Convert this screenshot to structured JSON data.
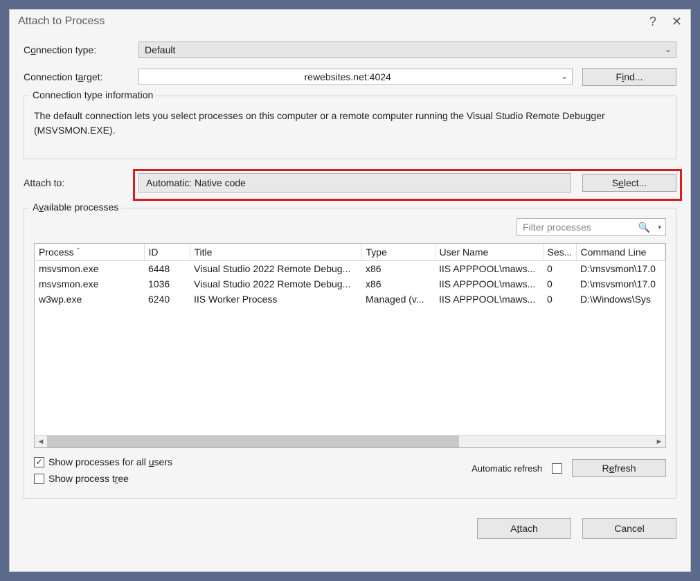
{
  "window": {
    "title": "Attach to Process",
    "help_icon": "?",
    "close_icon": "✕"
  },
  "labels": {
    "conn_type_pre": "C",
    "conn_type_u": "o",
    "conn_type_post": "nnection type:",
    "conn_target_pre": "Connection t",
    "conn_target_u": "a",
    "conn_target_post": "rget:",
    "attach_to": "Attach to:",
    "available_pre": "A",
    "available_u": "v",
    "available_post": "ailable processes",
    "conn_info": "Connection type information"
  },
  "values": {
    "conn_type": "Default",
    "conn_target": "rewebsites.net:4024",
    "attach_to": "Automatic: Native code"
  },
  "info_text": "The default connection lets you select processes on this computer or a remote computer running the Visual Studio Remote Debugger (MSVSMON.EXE).",
  "buttons": {
    "find_pre": "F",
    "find_u": "i",
    "find_post": "nd...",
    "select_pre": "S",
    "select_u": "e",
    "select_post": "lect...",
    "refresh_pre": "R",
    "refresh_u": "e",
    "refresh_post": "fresh",
    "attach_pre": "A",
    "attach_u": "t",
    "attach_post": "tach",
    "cancel": "Cancel"
  },
  "filter": {
    "placeholder": "Filter processes"
  },
  "columns": {
    "process": "Process",
    "id": "ID",
    "title": "Title",
    "type": "Type",
    "user": "User Name",
    "ses": "Ses...",
    "cmd": "Command Line"
  },
  "rows": [
    {
      "process": "msvsmon.exe",
      "id": "6448",
      "title": "Visual Studio 2022 Remote Debug...",
      "type": "x86",
      "user": "IIS APPPOOL\\maws...",
      "ses": "0",
      "cmd": "D:\\msvsmon\\17.0"
    },
    {
      "process": "msvsmon.exe",
      "id": "1036",
      "title": "Visual Studio 2022 Remote Debug...",
      "type": "x86",
      "user": "IIS APPPOOL\\maws...",
      "ses": "0",
      "cmd": "D:\\msvsmon\\17.0"
    },
    {
      "process": "w3wp.exe",
      "id": "6240",
      "title": "IIS Worker Process",
      "type": "Managed (v...",
      "user": "IIS APPPOOL\\maws...",
      "ses": "0",
      "cmd": "D:\\Windows\\Sys"
    }
  ],
  "checks": {
    "all_users_pre": "Show processes for all ",
    "all_users_u": "u",
    "all_users_post": "sers",
    "tree_pre": "Show process t",
    "tree_u": "r",
    "tree_post": "ee",
    "auto_refresh": "Automatic refresh"
  }
}
